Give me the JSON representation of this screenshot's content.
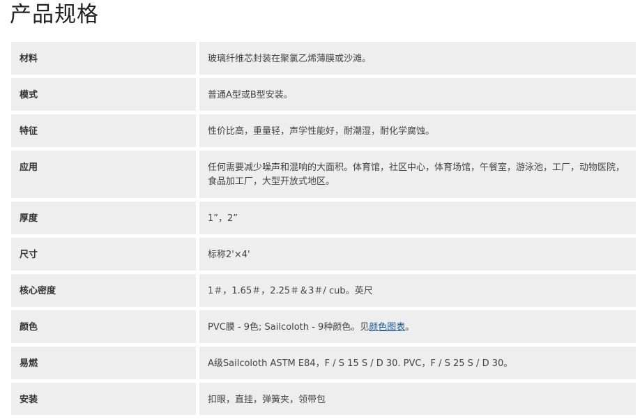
{
  "title": "产品规格",
  "specs": [
    {
      "label": "材料",
      "value": "玻璃纤维芯封装在聚氯乙烯薄膜或沙滩。"
    },
    {
      "label": "模式",
      "value": "普通A型或B型安装。"
    },
    {
      "label": "特征",
      "value": "性价比高，重量轻，声学性能好，耐潮湿，耐化学腐蚀。"
    },
    {
      "label": "应用",
      "value": "任何需要减少噪声和混响的大面积。体育馆，社区中心，体育场馆，午餐室，游泳池，工厂，动物医院，食品加工厂，大型开放式地区。"
    },
    {
      "label": "厚度",
      "value": "1”，2”"
    },
    {
      "label": "尺寸",
      "value": "标称2'×4'"
    },
    {
      "label": "核心密度",
      "value": "1＃，1.65＃，2.25＃＆3＃/ cub。英尺"
    },
    {
      "label": "颜色",
      "value_prefix": "PVC膜 - 9色; Sailcoloth - 9种颜色。见",
      "link_text": "颜色图表",
      "value_suffix": "。"
    },
    {
      "label": "易燃",
      "value": "A级Sailcoloth ASTM E84，F / S 15 S / D 30. PVC，F / S 25 S / D 30。"
    },
    {
      "label": "安装",
      "value": "扣眼，直挂，弹簧夹，领带包"
    }
  ],
  "colors": {
    "row_background": "#eeeeee",
    "link": "#1a5aa0"
  }
}
